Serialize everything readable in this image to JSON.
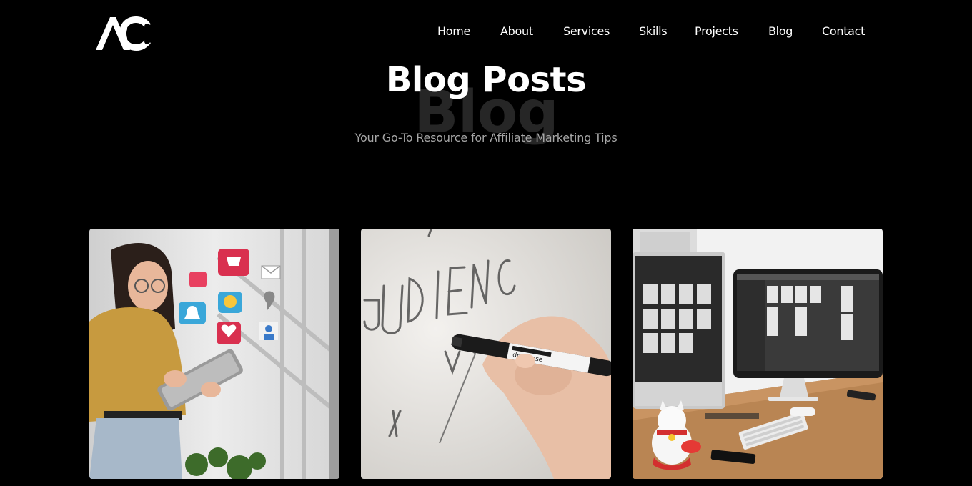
{
  "brand": {
    "logo_text": "AC"
  },
  "nav": {
    "items": [
      {
        "label": "Home"
      },
      {
        "label": "About"
      },
      {
        "label": "Services"
      },
      {
        "label": "Skills"
      },
      {
        "label": "Projects"
      },
      {
        "label": "Blog"
      },
      {
        "label": "Contact"
      }
    ]
  },
  "hero": {
    "title": "Blog Posts",
    "ghost_text": "Blog",
    "subtitle": "Your Go-To Resource for Affiliate Marketing Tips"
  },
  "posts": [
    {
      "image": "woman-with-tablet-and-social-media-icons"
    },
    {
      "image": "hand-writing-audience-on-whiteboard",
      "marker_label": "dry erase"
    },
    {
      "image": "desk-with-two-monitors-and-lucky-cat"
    }
  ],
  "colors": {
    "background": "#000000",
    "text": "#ffffff",
    "subtitle": "#a6a6a6",
    "ghost": "#262626"
  }
}
